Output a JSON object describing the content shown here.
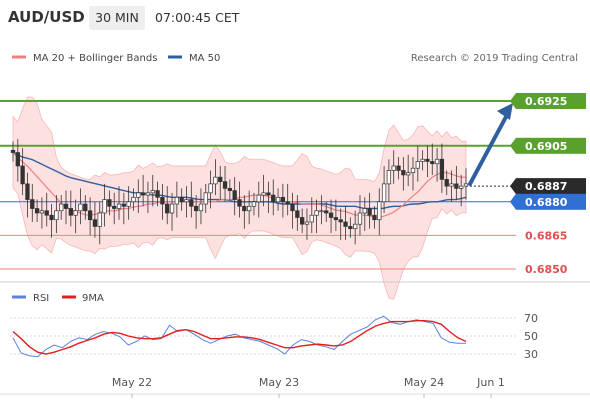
{
  "header": {
    "symbol": "AUD/USD",
    "timeframe": "30 MIN",
    "time": "07:00:45 CET"
  },
  "legend": {
    "ma20_label": "MA 20 + Bollinger Bands",
    "ma50_label": "MA 50",
    "ma20_color": "#f08080",
    "ma50_color": "#2f5f9e",
    "copyright": "Research © 2019 Trading Central"
  },
  "rsi_legend": {
    "rsi_label": "RSI",
    "ma_label": "9MA",
    "rsi_color": "#5b83d9",
    "ma_color": "#e02020"
  },
  "chart_data": [
    {
      "type": "candlestick",
      "ylim": [
        0.6846,
        0.6936
      ],
      "x_labels": [
        "May 22",
        "May 23",
        "May 24",
        "Jun 1"
      ],
      "levels": [
        {
          "value": 0.6925,
          "label": "0.6925",
          "kind": "resistance",
          "color": "#5aa02c"
        },
        {
          "value": 0.6905,
          "label": "0.6905",
          "kind": "resistance",
          "color": "#5aa02c"
        },
        {
          "value": 0.6887,
          "label": "0.6887",
          "kind": "last-price",
          "color": "#2a2a2a"
        },
        {
          "value": 0.688,
          "label": "0.6880",
          "kind": "pivot",
          "color": "#2f6fd6"
        },
        {
          "value": 0.6865,
          "label": "0.6865",
          "kind": "support",
          "color": "#f08080"
        },
        {
          "value": 0.685,
          "label": "0.6850",
          "kind": "support",
          "color": "#f08080"
        }
      ],
      "price_path": [
        0.6902,
        0.6896,
        0.6888,
        0.6881,
        0.6877,
        0.6875,
        0.6876,
        0.6874,
        0.6872,
        0.6876,
        0.6879,
        0.6877,
        0.6874,
        0.6876,
        0.6879,
        0.6876,
        0.6872,
        0.6869,
        0.6875,
        0.6881,
        0.6878,
        0.6877,
        0.6879,
        0.6878,
        0.688,
        0.6882,
        0.6884,
        0.6883,
        0.6884,
        0.6885,
        0.6882,
        0.6879,
        0.6875,
        0.6879,
        0.6882,
        0.688,
        0.6881,
        0.6878,
        0.6876,
        0.6879,
        0.6884,
        0.6888,
        0.6891,
        0.6889,
        0.6886,
        0.6885,
        0.6881,
        0.6878,
        0.6876,
        0.6878,
        0.688,
        0.6883,
        0.6884,
        0.6883,
        0.688,
        0.6882,
        0.688,
        0.6879,
        0.6876,
        0.6873,
        0.687,
        0.6871,
        0.6874,
        0.6876,
        0.6876,
        0.6875,
        0.6873,
        0.6872,
        0.6871,
        0.6869,
        0.6868,
        0.687,
        0.6875,
        0.6877,
        0.6874,
        0.6872,
        0.688,
        0.6888,
        0.6894,
        0.6896,
        0.6894,
        0.6892,
        0.6893,
        0.6895,
        0.6898,
        0.6899,
        0.6898,
        0.6897,
        0.6899,
        0.689,
        0.6887,
        0.6888,
        0.6886,
        0.6887,
        0.6888
      ],
      "ma20": [
        0.6902,
        0.6899,
        0.6897,
        0.6894,
        0.6891,
        0.6888,
        0.6885,
        0.6882,
        0.6879,
        0.6877,
        0.6876,
        0.6875,
        0.6874,
        0.6874,
        0.6875,
        0.6876,
        0.6876,
        0.6876,
        0.6877,
        0.6877,
        0.6878,
        0.6878,
        0.6879,
        0.6879,
        0.688,
        0.688,
        0.688,
        0.688,
        0.688,
        0.688,
        0.688,
        0.688,
        0.688,
        0.688,
        0.6881,
        0.6881,
        0.6881,
        0.6882,
        0.6882,
        0.6883,
        0.6883,
        0.6883,
        0.6882,
        0.6881,
        0.688,
        0.688,
        0.688,
        0.6879,
        0.6879,
        0.6879,
        0.6879,
        0.6878,
        0.6877,
        0.6876,
        0.6876,
        0.6875,
        0.6874,
        0.6874,
        0.6874,
        0.6873,
        0.6873,
        0.6874,
        0.6875,
        0.6877,
        0.6879,
        0.6882,
        0.6884,
        0.6887,
        0.689,
        0.6892,
        0.6893,
        0.6893,
        0.6892,
        0.6891,
        0.6891
      ],
      "ma50": [
        0.6902,
        0.69,
        0.6899,
        0.6897,
        0.6895,
        0.6893,
        0.6891,
        0.689,
        0.6889,
        0.6888,
        0.6887,
        0.6886,
        0.6885,
        0.6884,
        0.6884,
        0.6883,
        0.6883,
        0.6882,
        0.6882,
        0.6882,
        0.6881,
        0.6881,
        0.6881,
        0.6881,
        0.688,
        0.688,
        0.688,
        0.688,
        0.688,
        0.6879,
        0.6879,
        0.6879,
        0.6879,
        0.6879,
        0.6879,
        0.6878,
        0.6878,
        0.6878,
        0.6877,
        0.6877,
        0.6877,
        0.6878,
        0.6878,
        0.6879,
        0.6879,
        0.688,
        0.688,
        0.6881,
        0.6881,
        0.6882
      ],
      "forecast_target": 0.6925
    },
    {
      "type": "line",
      "title": "RSI",
      "ylim": [
        20,
        80
      ],
      "y_ticks": [
        30,
        50,
        70
      ],
      "series": [
        {
          "name": "RSI",
          "values": [
            48,
            31,
            28,
            27,
            35,
            40,
            37,
            44,
            48,
            46,
            52,
            55,
            53,
            49,
            40,
            44,
            50,
            46,
            47,
            62,
            55,
            57,
            52,
            46,
            42,
            46,
            50,
            52,
            48,
            46,
            44,
            40,
            36,
            30,
            40,
            46,
            44,
            40,
            38,
            35,
            44,
            52,
            56,
            60,
            68,
            72,
            65,
            63,
            66,
            68,
            66,
            64,
            48,
            43,
            42,
            42
          ]
        },
        {
          "name": "9MA",
          "values": [
            55,
            47,
            38,
            32,
            30,
            32,
            35,
            38,
            42,
            45,
            48,
            52,
            54,
            53,
            50,
            48,
            47,
            47,
            48,
            52,
            56,
            57,
            55,
            51,
            47,
            47,
            48,
            49,
            49,
            48,
            46,
            43,
            40,
            37,
            37,
            39,
            40,
            41,
            40,
            39,
            40,
            44,
            50,
            56,
            61,
            64,
            66,
            66,
            66,
            67,
            67,
            66,
            63,
            55,
            48,
            44
          ]
        }
      ]
    }
  ]
}
